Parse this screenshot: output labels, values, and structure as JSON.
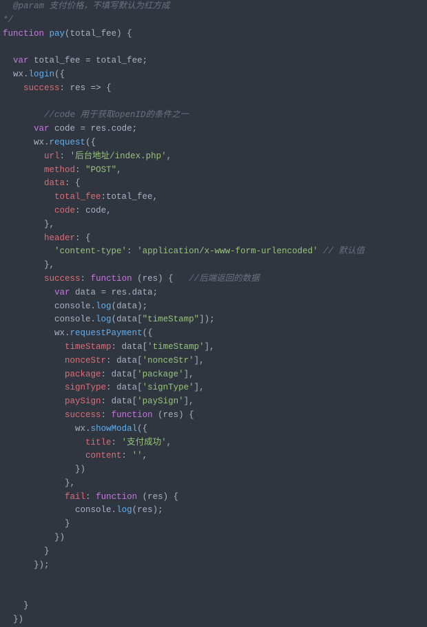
{
  "code": {
    "c1": "  @param 支付价格，不填写默认为红方成",
    "c2": "*/",
    "fn_kw": "function",
    "fn_name": "pay",
    "fn_arg": "total_fee",
    "var_kw": "var",
    "assign1_lhs": "total_fee",
    "assign1_rhs": "total_fee",
    "wx": "wx",
    "login": "login",
    "success": "success",
    "res": "res",
    "arrow": " => {",
    "c3": "//code 用于获取openID的条件之一",
    "code_var": "code",
    "res_code": "res.code",
    "request": "request",
    "url_k": "url",
    "url_v": "'后台地址/index.php'",
    "method_k": "method",
    "method_v": "\"POST\"",
    "data_k": "data",
    "tf_k": "total_fee",
    "tf_v": "total_fee",
    "cd_k": "code",
    "cd_v": "code",
    "header_k": "header",
    "ct_k": "'content-type'",
    "ct_v": "'application/x-www-form-urlencoded'",
    "ct_c": "// 默认值",
    "func_kw": "function",
    "c4": "//后端返回的数据",
    "data_var": "data",
    "res_data": "res.data",
    "console": "console",
    "log": "log",
    "ts_idx": "\"timeStamp\"",
    "reqpay": "requestPayment",
    "k_ts": "timeStamp",
    "v_ts": "'timeStamp'",
    "k_ns": "nonceStr",
    "v_ns": "'nonceStr'",
    "k_pk": "package",
    "v_pk": "'package'",
    "k_st": "signType",
    "v_st": "'signType'",
    "k_ps": "paySign",
    "v_ps": "'paySign'",
    "showModal": "showModal",
    "title_k": "title",
    "title_v": "'支付成功'",
    "content_k": "content",
    "content_v": "''",
    "fail_k": "fail"
  }
}
